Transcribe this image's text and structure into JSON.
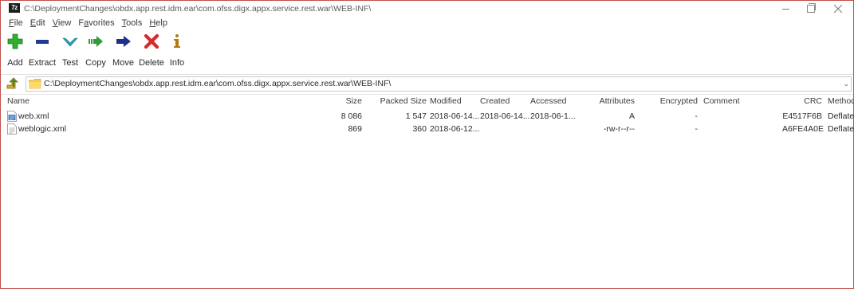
{
  "titlebar": {
    "app_icon_text": "7z",
    "title": "C:\\DeploymentChanges\\obdx.app.rest.idm.ear\\com.ofss.digx.appx.service.rest.war\\WEB-INF\\"
  },
  "menu": [
    {
      "label": "File",
      "underline": "F",
      "rest": "ile"
    },
    {
      "label": "Edit",
      "underline": "E",
      "rest": "dit"
    },
    {
      "label": "View",
      "underline": "V",
      "rest": "iew"
    },
    {
      "label": "Favorites",
      "prefix": "F",
      "underline": "a",
      "rest": "vorites"
    },
    {
      "label": "Tools",
      "underline": "T",
      "rest": "ools"
    },
    {
      "label": "Help",
      "underline": "H",
      "rest": "elp"
    }
  ],
  "toolbar": {
    "add": "Add",
    "extract": "Extract",
    "test": "Test",
    "copy": "Copy",
    "move": "Move",
    "delete": "Delete",
    "info": "Info"
  },
  "icons": {
    "add": "plus-icon",
    "extract": "minus-icon",
    "test": "check-chevron-icon",
    "copy": "copy-arrow-icon",
    "move": "move-arrow-icon",
    "delete": "x-icon",
    "info": "info-icon",
    "up": "up-folder-icon",
    "folder": "folder-icon",
    "dropdown": "chevron-down-icon"
  },
  "colors": {
    "add": "#2fae2f",
    "extract": "#1f3a93",
    "test": "#26a0b5",
    "copy": "#2f9a3a",
    "move": "#1c2f8a",
    "delete": "#d42a2a",
    "info": "#b07b10",
    "window_border": "#c0504d"
  },
  "address": {
    "path": "C:\\DeploymentChanges\\obdx.app.rest.idm.ear\\com.ofss.digx.appx.service.rest.war\\WEB-INF\\",
    "dropdown": "⌄"
  },
  "columns": {
    "name": "Name",
    "size": "Size",
    "packed_size": "Packed Size",
    "modified": "Modified",
    "created": "Created",
    "accessed": "Accessed",
    "attributes": "Attributes",
    "encrypted": "Encrypted",
    "comment": "Comment",
    "crc": "CRC",
    "method": "Method"
  },
  "files": [
    {
      "name": "web.xml",
      "size": "8 086",
      "packed_size": "1 547",
      "modified": "2018-06-14...",
      "created": "2018-06-14...",
      "accessed": "2018-06-1...",
      "attributes": "A",
      "encrypted": "-",
      "comment": "",
      "crc": "E4517F6B",
      "method": "Deflate"
    },
    {
      "name": "weblogic.xml",
      "size": "869",
      "packed_size": "360",
      "modified": "2018-06-12...",
      "created": "",
      "accessed": "",
      "attributes": "-rw-r--r--",
      "encrypted": "-",
      "comment": "",
      "crc": "A6FE4A0E",
      "method": "Deflate"
    }
  ]
}
